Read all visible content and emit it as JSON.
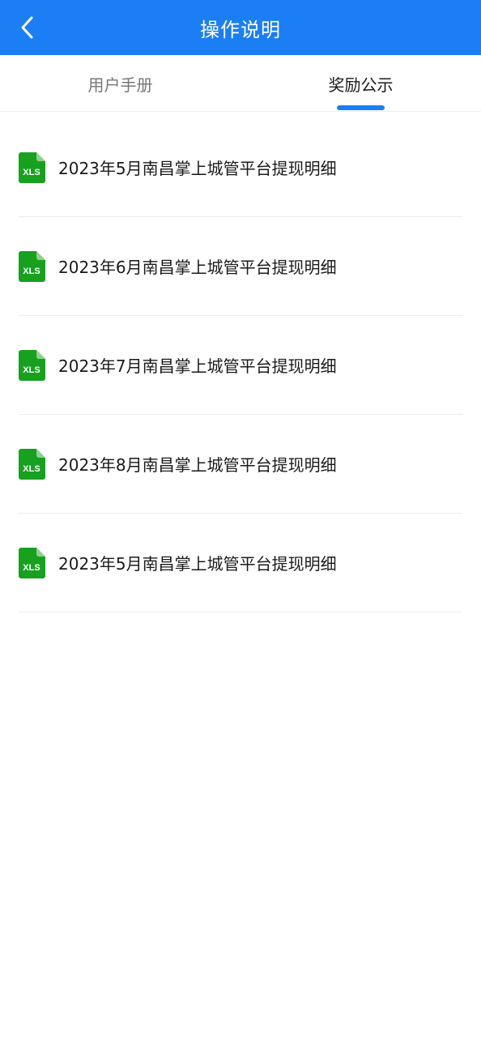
{
  "header": {
    "title": "操作说明",
    "back_icon": "chevron-left-icon",
    "background_color": "#1b7ef5"
  },
  "tabs": [
    {
      "label": "用户手册",
      "active": false
    },
    {
      "label": "奖励公示",
      "active": true
    }
  ],
  "accent_color": "#1b7ef5",
  "file_list": {
    "icon": "xls-file-icon",
    "icon_text": "XLS",
    "icon_color": "#17a11f",
    "items": [
      {
        "title": "2023年5月南昌掌上城管平台提现明细"
      },
      {
        "title": "2023年6月南昌掌上城管平台提现明细"
      },
      {
        "title": "2023年7月南昌掌上城管平台提现明细"
      },
      {
        "title": "2023年8月南昌掌上城管平台提现明细"
      },
      {
        "title": "2023年5月南昌掌上城管平台提现明细"
      }
    ]
  }
}
